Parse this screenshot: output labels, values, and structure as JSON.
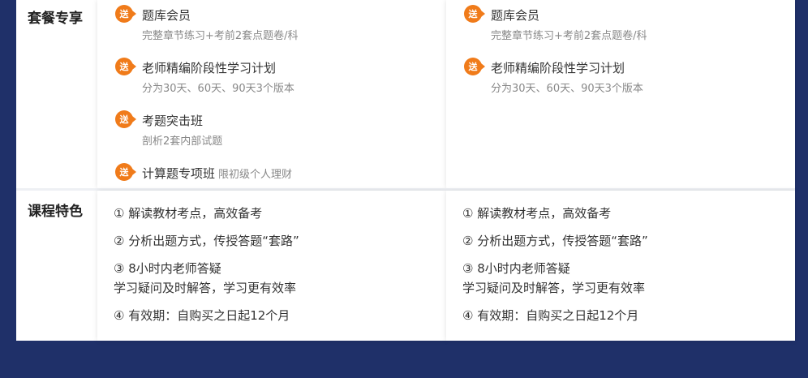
{
  "labels": {
    "package": "套餐专享",
    "features": "课程特色"
  },
  "badge_text": "送",
  "columns": [
    {
      "bonuses": [
        {
          "title": "题库会员",
          "sub": "完整章节练习+考前2套点题卷/科"
        },
        {
          "title": "老师精编阶段性学习计划",
          "sub": "分为30天、60天、90天3个版本"
        },
        {
          "title": "考题突击班",
          "sub": "剖析2套内部试题"
        },
        {
          "title": "计算题专项班",
          "inline": "限初级个人理财"
        }
      ],
      "features": [
        "① 解读教材考点，高效备考",
        "② 分析出题方式，传授答题“套路”",
        "③ 8小时内老师答疑",
        "学习疑问及时解答，学习更有效率",
        "④ 有效期：自购买之日起12个月"
      ]
    },
    {
      "bonuses": [
        {
          "title": "题库会员",
          "sub": "完整章节练习+考前2套点题卷/科"
        },
        {
          "title": "老师精编阶段性学习计划",
          "sub": "分为30天、60天、90天3个版本"
        }
      ],
      "features": [
        "① 解读教材考点，高效备考",
        "② 分析出题方式，传授答题“套路”",
        "③ 8小时内老师答疑",
        "学习疑问及时解答，学习更有效率",
        "④ 有效期：自购买之日起12个月"
      ]
    }
  ],
  "colors": {
    "background": "#1f3069",
    "badge": "#f07b1a"
  }
}
